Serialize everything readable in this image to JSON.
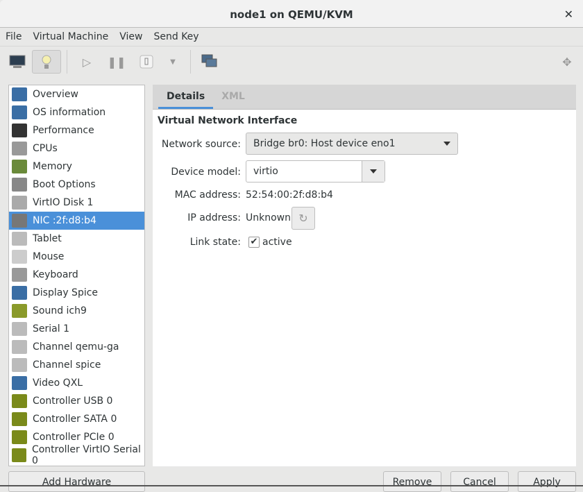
{
  "window": {
    "title": "node1 on QEMU/KVM",
    "close": "✕"
  },
  "menu": [
    "File",
    "Virtual Machine",
    "View",
    "Send Key"
  ],
  "toolbar": {
    "icons": [
      "monitor-icon",
      "lightbulb-icon",
      "play-icon",
      "pause-icon",
      "power-icon",
      "dropdown-icon",
      "snapshots-icon",
      "fullscreen-icon"
    ]
  },
  "sidebar": {
    "items": [
      {
        "label": "Overview",
        "color": "#3a6ea5"
      },
      {
        "label": "OS information",
        "color": "#3a6ea5"
      },
      {
        "label": "Performance",
        "color": "#333"
      },
      {
        "label": "CPUs",
        "color": "#999"
      },
      {
        "label": "Memory",
        "color": "#6a8a3a"
      },
      {
        "label": "Boot Options",
        "color": "#888"
      },
      {
        "label": "VirtIO Disk 1",
        "color": "#aaa"
      },
      {
        "label": "NIC :2f:d8:b4",
        "color": "#777"
      },
      {
        "label": "Tablet",
        "color": "#bbb"
      },
      {
        "label": "Mouse",
        "color": "#ccc"
      },
      {
        "label": "Keyboard",
        "color": "#999"
      },
      {
        "label": "Display Spice",
        "color": "#3a6ea5"
      },
      {
        "label": "Sound ich9",
        "color": "#8a9a2a"
      },
      {
        "label": "Serial 1",
        "color": "#bbb"
      },
      {
        "label": "Channel qemu-ga",
        "color": "#bbb"
      },
      {
        "label": "Channel spice",
        "color": "#bbb"
      },
      {
        "label": "Video QXL",
        "color": "#3a6ea5"
      },
      {
        "label": "Controller USB 0",
        "color": "#7a8a1a"
      },
      {
        "label": "Controller SATA 0",
        "color": "#7a8a1a"
      },
      {
        "label": "Controller PCIe 0",
        "color": "#7a8a1a"
      },
      {
        "label": "Controller VirtIO Serial 0",
        "color": "#7a8a1a"
      }
    ],
    "selected": 7
  },
  "tabs": [
    "Details",
    "XML"
  ],
  "details": {
    "section": "Virtual Network Interface",
    "network_source_label": "Network source:",
    "network_source": "Bridge br0: Host device eno1",
    "device_model_label": "Device model:",
    "device_model": "virtio",
    "mac_label": "MAC address:",
    "mac": "52:54:00:2f:d8:b4",
    "ip_label": "IP address:",
    "ip": "Unknown",
    "link_label": "Link state:",
    "link": "active",
    "link_checked": true
  },
  "buttons": {
    "add": "Add Hardware",
    "remove": "Remove",
    "cancel": "Cancel",
    "apply": "Apply"
  }
}
